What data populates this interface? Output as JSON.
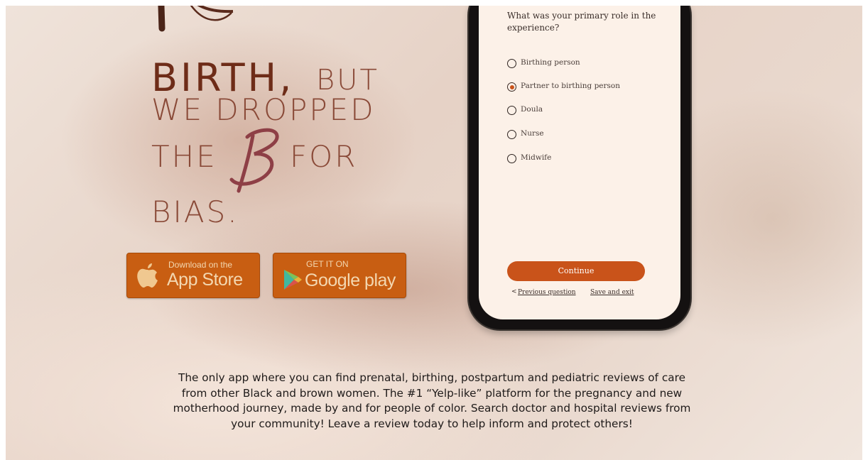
{
  "headline": {
    "birth": "BIRTH,",
    "but": "BUT",
    "dropped": "WE DROPPED",
    "the": "THE",
    "for": "FOR",
    "bias": "BIAS."
  },
  "store_buttons": {
    "appstore": {
      "small": "Download on the",
      "big": "App Store"
    },
    "googleplay": {
      "small": "GET IT ON",
      "big": "Google play"
    }
  },
  "survey": {
    "question": "What was your primary role in the experience?",
    "options": [
      {
        "label": "Birthing person",
        "selected": false
      },
      {
        "label": "Partner to birthing person",
        "selected": true
      },
      {
        "label": "Doula",
        "selected": false
      },
      {
        "label": "Nurse",
        "selected": false
      },
      {
        "label": "Midwife",
        "selected": false
      }
    ],
    "continue_label": "Continue",
    "previous_label": "Previous question",
    "previous_chevron": "<",
    "save_label": "Save and exit"
  },
  "description": "The only app where you can find prenatal, birthing, postpartum and pediatric reviews of care from other Black and brown women. The #1 “Yelp-like” platform for the pregnancy and new motherhood journey, made by and for people of color. Search doctor and hospital reviews from your community! Leave a review today to help inform and protect others!",
  "colors": {
    "accent": "#c9531a",
    "store_button": "#c85e12",
    "headline": "#7a3b2a",
    "script_letter": "#8e3f46"
  },
  "icons": {
    "logo": "brush-logo-mark",
    "script": "script-b-letter",
    "apple": "apple-icon",
    "play": "play-triangle-icon"
  }
}
